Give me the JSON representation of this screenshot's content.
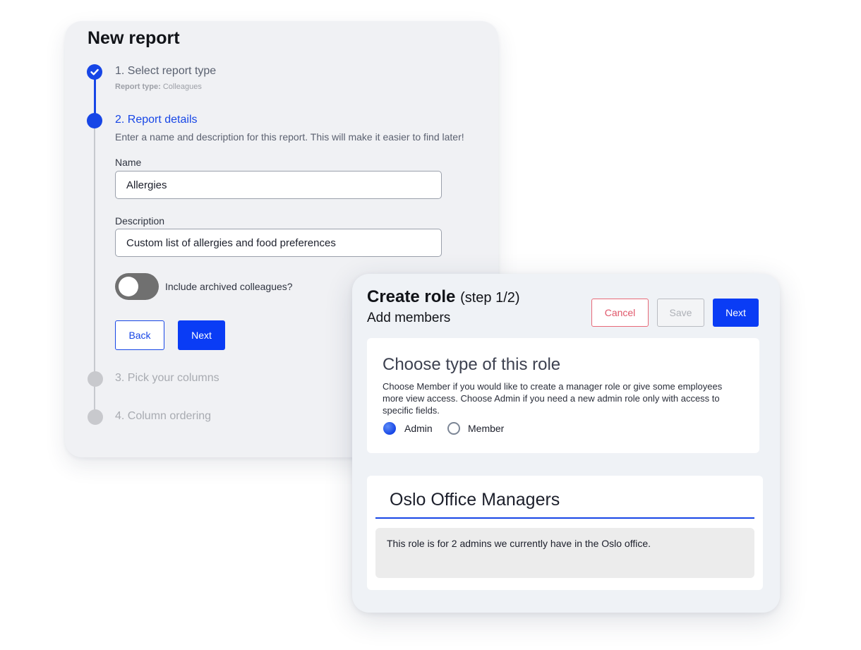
{
  "new_report": {
    "title": "New report",
    "steps": [
      {
        "label": "1. Select report type",
        "sub_label": "Report type:",
        "sub_value": "Colleagues"
      },
      {
        "label": "2. Report details",
        "help": "Enter a name and description for this report. This will make it easier to find later!"
      },
      {
        "label": "3. Pick your columns"
      },
      {
        "label": "4. Column ordering"
      }
    ],
    "name_label": "Name",
    "name_value": "Allergies",
    "description_label": "Description",
    "description_value": "Custom list of allergies and food preferences",
    "toggle_label": "Include archived colleagues?",
    "back_label": "Back",
    "next_label": "Next"
  },
  "create_role": {
    "title": "Create role",
    "step": "(step 1/2)",
    "subtitle": "Add members",
    "cancel_label": "Cancel",
    "save_label": "Save",
    "next_label": "Next",
    "type_title": "Choose type of this role",
    "type_description": "Choose Member if you would like to create a manager role or give some employees more view access. Choose Admin if you need a new admin role only with access to specific fields.",
    "options": [
      {
        "label": "Admin",
        "selected": true
      },
      {
        "label": "Member",
        "selected": false
      }
    ],
    "role_name": "Oslo Office Managers",
    "role_description": "This role is for 2 admins we currently have in the Oslo office."
  },
  "colors": {
    "accent": "#1746e6",
    "primary_button": "#0a3cf5",
    "cancel": "#e0576a",
    "inactive_step": "#c8c9cd"
  }
}
